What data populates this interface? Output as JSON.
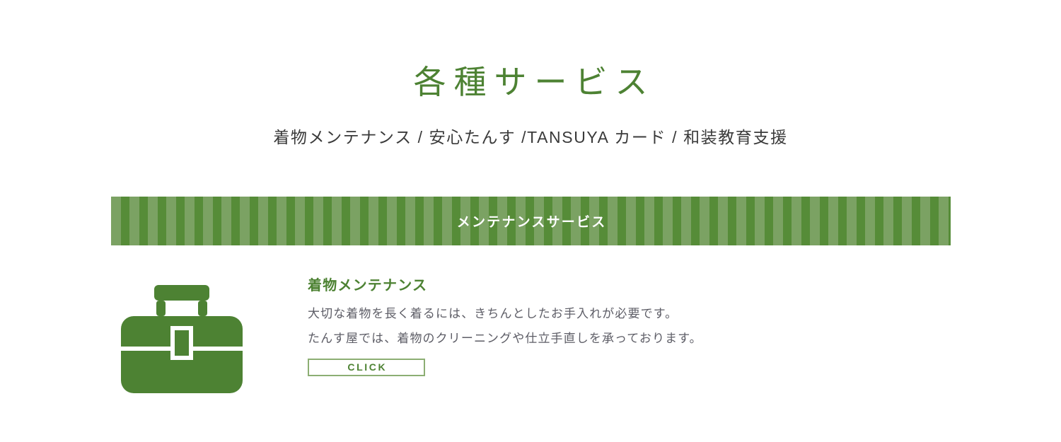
{
  "page": {
    "title": "各種サービス",
    "subtitle": "着物メンテナンス / 安心たんす /TANSUYA カード / 和装教育支援",
    "accent_color": "#4d8233",
    "banner_light_stripe": "#7ba263",
    "banner_dark_stripe": "#568c38",
    "body_text_color": "#5d5d66",
    "background_color": "#ffffff"
  },
  "section": {
    "banner_label": "メンテナンスサービス"
  },
  "service": {
    "icon_name": "briefcase-icon",
    "heading": "着物メンテナンス",
    "line1": "大切な着物を長く着るには、きちんとしたお手入れが必要です。",
    "line2": "たんす屋では、着物のクリーニングや仕立手直しを承っております。",
    "button_label": "CLICK"
  }
}
